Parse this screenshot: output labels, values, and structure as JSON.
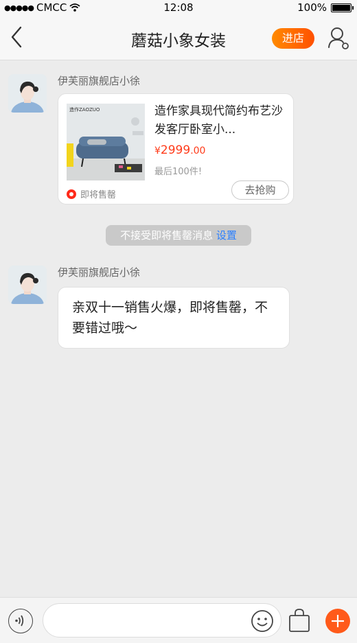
{
  "status_bar": {
    "signal_dots": "●●●●●",
    "carrier": "CMCC",
    "time": "12:08",
    "battery_percent": "100%",
    "battery_level": 1.0
  },
  "nav": {
    "title": "蘑菇小象女装",
    "enter_shop_label": "进店",
    "icons": {
      "back": "chevron-left-icon",
      "profile": "user-settings-icon"
    }
  },
  "messages": [
    {
      "sender": "伊芙丽旗舰店小徐",
      "type": "product",
      "product": {
        "image_brand": "造作ZAOZUO",
        "title": "造作家具现代简约布艺沙发客厅卧室小...",
        "price_symbol": "¥",
        "price_main": "2999",
        "price_cents": ".00",
        "stock_note": "最后100件!",
        "tag": "即将售罄",
        "button_label": "去抢购"
      }
    },
    {
      "type": "system",
      "text": "不接受即将售罄消息",
      "link_text": "设置"
    },
    {
      "sender": "伊芙丽旗舰店小徐",
      "type": "text",
      "text": "亲双十一销售火爆，即将售罄，不要错过哦～"
    }
  ],
  "input_bar": {
    "placeholder": "",
    "icons": {
      "voice": "voice-icon",
      "emoji": "emoji-icon",
      "bag": "shopping-bag-icon",
      "plus": "plus-icon"
    }
  },
  "colors": {
    "accent_orange": "#ff5000",
    "price_red": "#ff3b1a",
    "link_blue": "#2a7fff",
    "background": "#ececec"
  }
}
